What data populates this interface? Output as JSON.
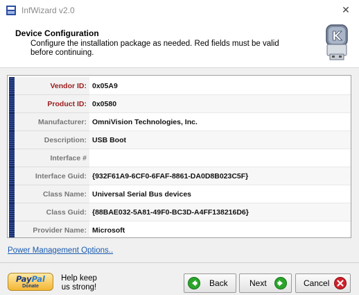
{
  "window": {
    "title": "InfWizard v2.0"
  },
  "header": {
    "title": "Device Configuration",
    "subtitle": "Configure the installation package as needed. Red fields must be valid before continuing."
  },
  "fields": [
    {
      "label": "Vendor ID:",
      "value": "0x05A9",
      "required": true
    },
    {
      "label": "Product ID:",
      "value": "0x0580",
      "required": true
    },
    {
      "label": "Manufacturer:",
      "value": "OmniVision Technologies, Inc.",
      "required": false
    },
    {
      "label": "Description:",
      "value": "USB Boot",
      "required": false
    },
    {
      "label": "Interface #",
      "value": "",
      "required": false
    },
    {
      "label": "Interface Guid:",
      "value": "{932F61A9-6CF0-6FAF-8861-DA0D8B023C5F}",
      "required": false
    },
    {
      "label": "Class Name:",
      "value": "Universal Serial Bus devices",
      "required": false
    },
    {
      "label": "Class Guid:",
      "value": "{88BAE032-5A81-49F0-BC3D-A4FF138216D6}",
      "required": false
    },
    {
      "label": "Provider Name:",
      "value": "Microsoft",
      "required": false
    }
  ],
  "links": {
    "power": "Power Management Options.."
  },
  "footer": {
    "paypal_word_1": "Pay",
    "paypal_word_2": "Pal",
    "paypal_donate": "Donate",
    "keep_text": "Help keep us strong!",
    "back_label": "Back",
    "next_label": "Next",
    "cancel_label": "Cancel"
  },
  "colors": {
    "required_label": "#9a1c1c",
    "link": "#1a5bb0",
    "row_bar": "#1b2f6b",
    "back_icon": "#2aa52a",
    "next_icon": "#2aa52a",
    "cancel_icon": "#d0202a"
  },
  "icons": {
    "app": "infwizard-app-icon",
    "header_logo": "usb-key-logo-icon",
    "back": "green-back-arrow-icon",
    "next": "green-next-arrow-icon",
    "cancel": "red-x-icon",
    "close": "close-icon"
  }
}
